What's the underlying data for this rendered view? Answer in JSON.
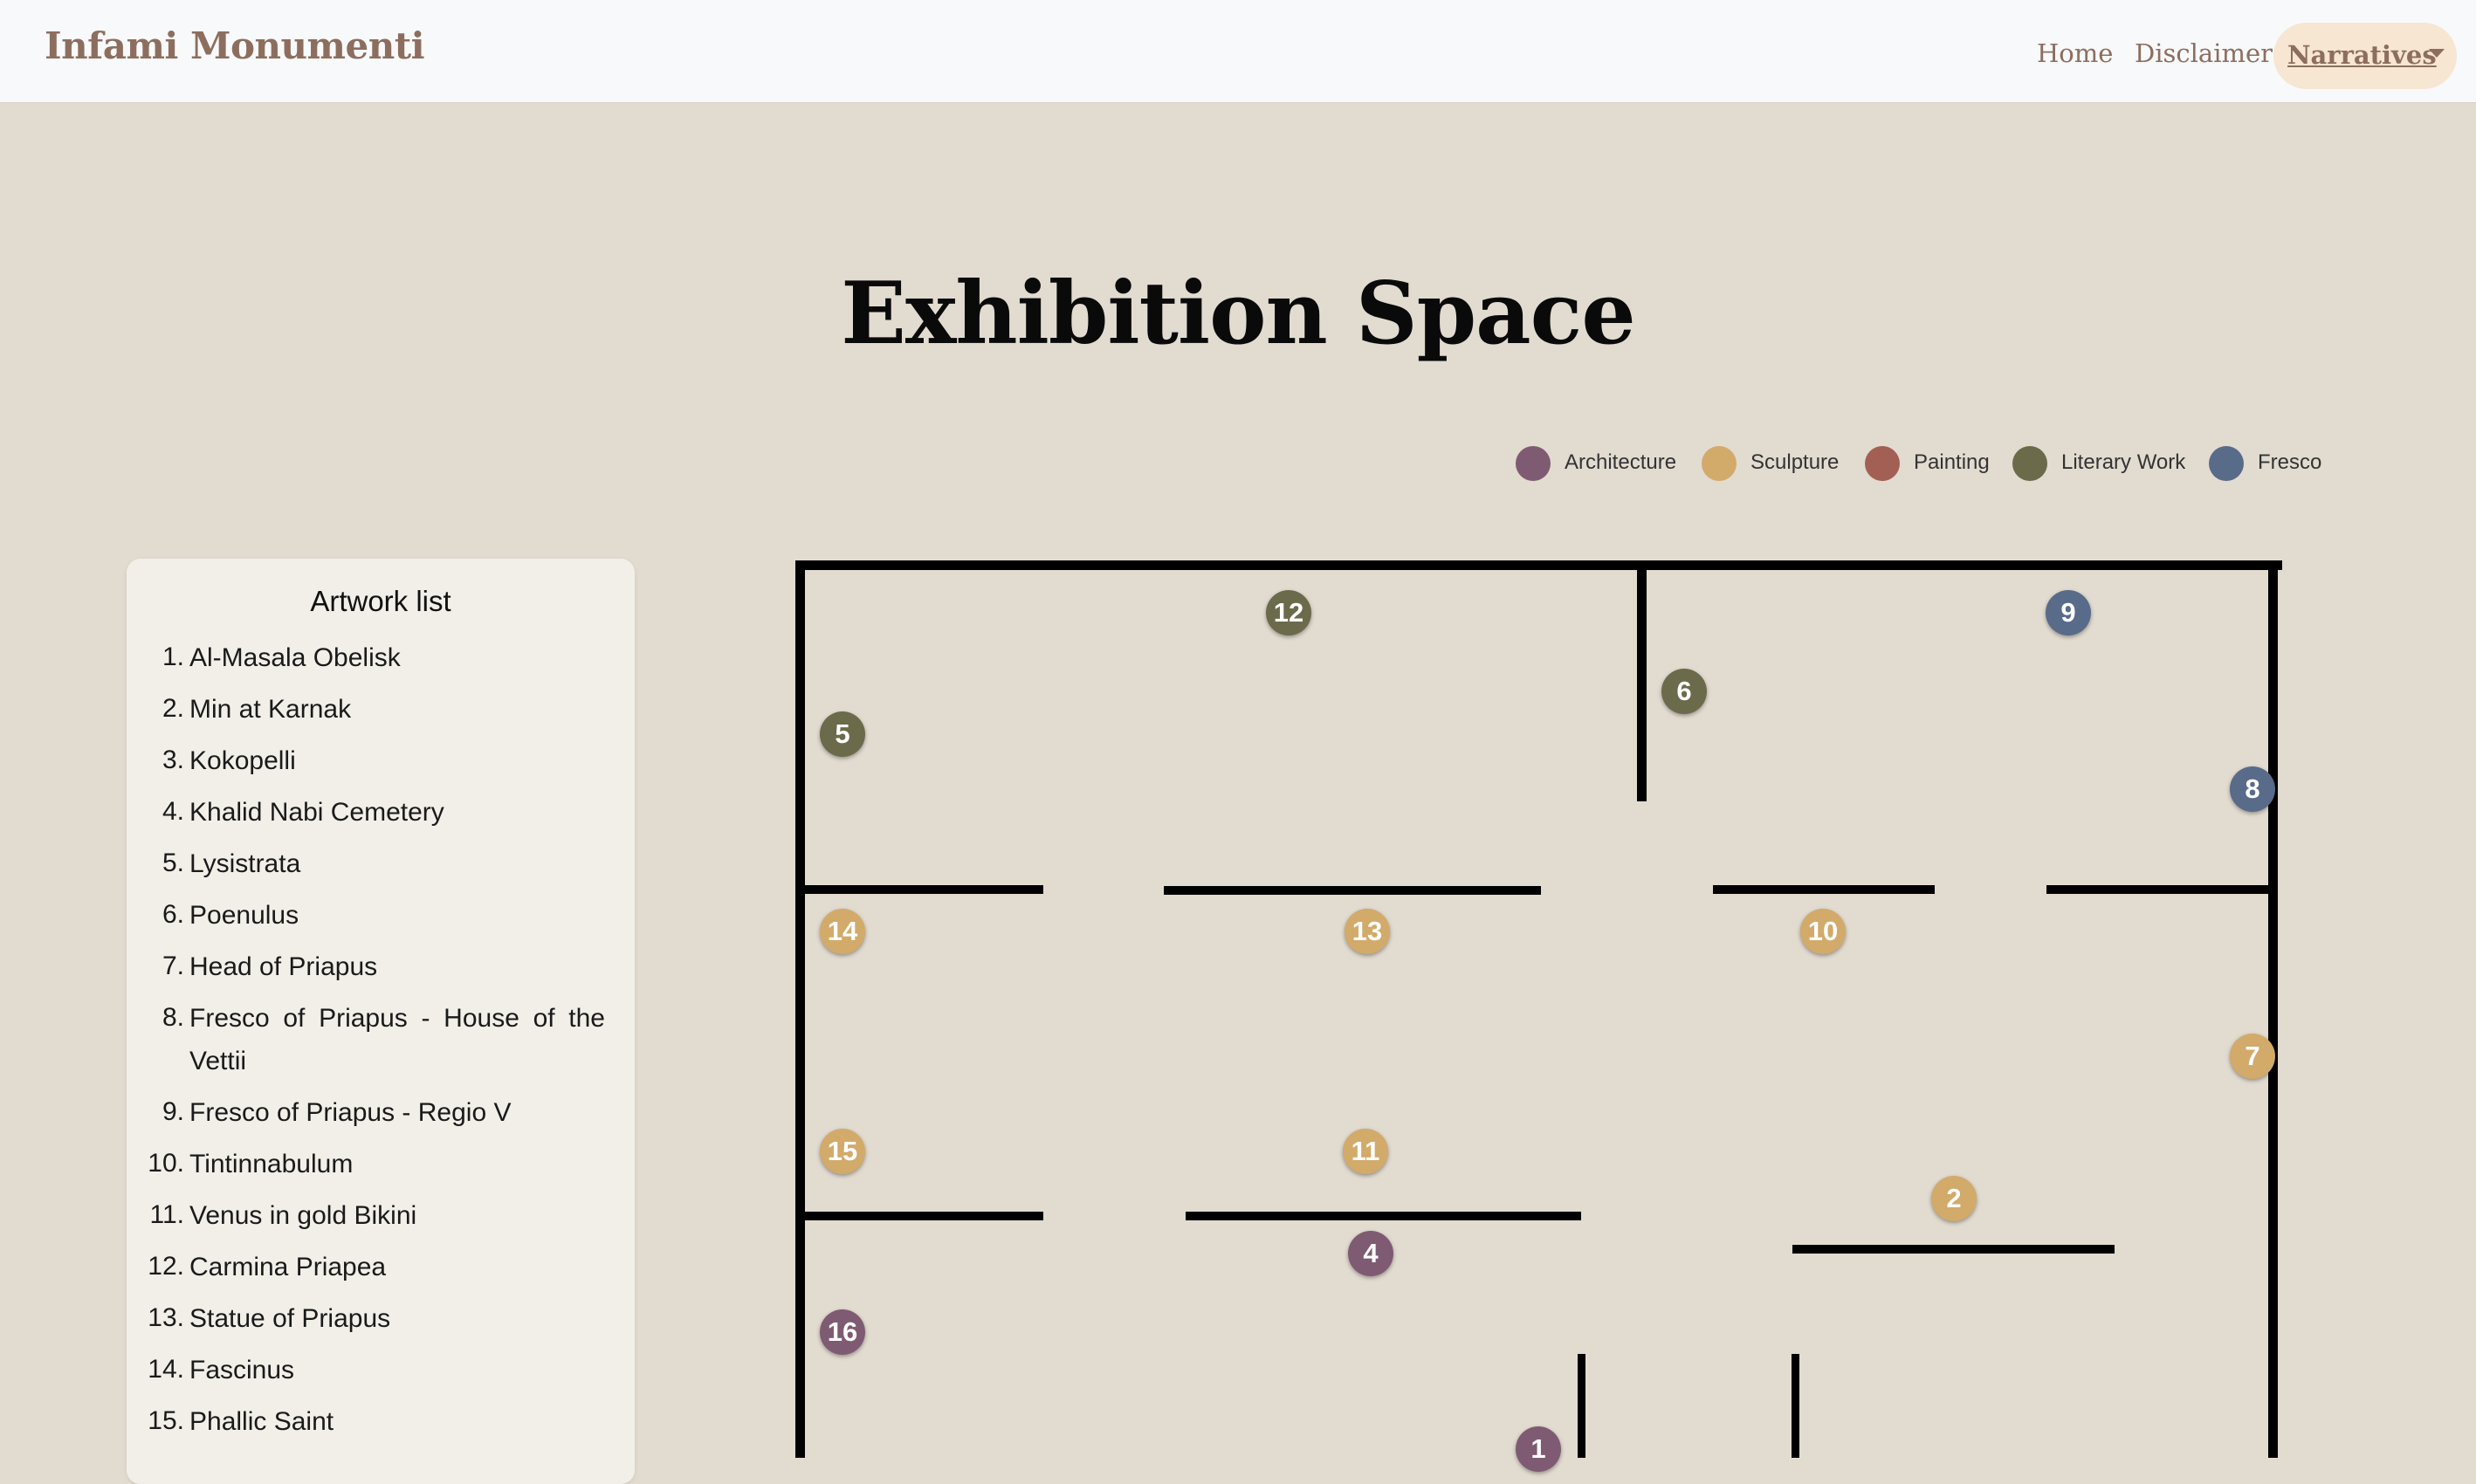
{
  "navbar": {
    "brand": "Infami Monumenti",
    "links": [
      "Home",
      "Disclaimer"
    ],
    "dropdown_label": "Narratives"
  },
  "page_title": "Exhibition Space",
  "legend": [
    {
      "label": "Architecture",
      "color": "#7e5b72"
    },
    {
      "label": "Sculpture",
      "color": "#d2aa6a"
    },
    {
      "label": "Painting",
      "color": "#a35f54"
    },
    {
      "label": "Literary Work",
      "color": "#6b6a4a"
    },
    {
      "label": "Fresco",
      "color": "#586b89"
    }
  ],
  "artwork_list": {
    "title": "Artwork list",
    "items": [
      {
        "num": "1.",
        "name": "Al-Masala Obelisk"
      },
      {
        "num": "2.",
        "name": "Min at Karnak"
      },
      {
        "num": "3.",
        "name": "Kokopelli"
      },
      {
        "num": "4.",
        "name": "Khalid Nabi Cemetery"
      },
      {
        "num": "5.",
        "name": "Lysistrata"
      },
      {
        "num": "6.",
        "name": "Poenulus"
      },
      {
        "num": "7.",
        "name": "Head of Priapus"
      },
      {
        "num": "8.",
        "name": "Fresco of Priapus - House of the Vettii"
      },
      {
        "num": "9.",
        "name": "Fresco of Priapus - Regio V"
      },
      {
        "num": "10.",
        "name": "Tintinnabulum"
      },
      {
        "num": "11.",
        "name": "Venus in gold Bikini"
      },
      {
        "num": "12.",
        "name": "Carmina Priapea"
      },
      {
        "num": "13.",
        "name": "Statue of Priapus"
      },
      {
        "num": "14.",
        "name": "Fascinus"
      },
      {
        "num": "15.",
        "name": "Phallic Saint"
      }
    ]
  },
  "markers": [
    {
      "label": "12",
      "category": "Literary Work"
    },
    {
      "label": "9",
      "category": "Fresco"
    },
    {
      "label": "6",
      "category": "Literary Work"
    },
    {
      "label": "5",
      "category": "Literary Work"
    },
    {
      "label": "8",
      "category": "Fresco"
    },
    {
      "label": "14",
      "category": "Sculpture"
    },
    {
      "label": "13",
      "category": "Sculpture"
    },
    {
      "label": "10",
      "category": "Sculpture"
    },
    {
      "label": "7",
      "category": "Sculpture"
    },
    {
      "label": "15",
      "category": "Sculpture"
    },
    {
      "label": "11",
      "category": "Sculpture"
    },
    {
      "label": "2",
      "category": "Sculpture"
    },
    {
      "label": "4",
      "category": "Architecture"
    },
    {
      "label": "16",
      "category": "Architecture"
    },
    {
      "label": "1",
      "category": "Architecture"
    }
  ]
}
